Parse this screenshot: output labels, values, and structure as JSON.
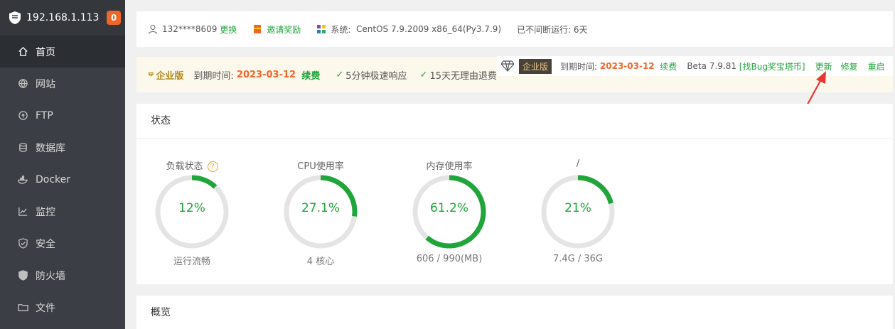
{
  "sidebar": {
    "ip": "192.168.1.113",
    "badge": "0",
    "items": [
      {
        "label": "首页",
        "icon": "home-icon"
      },
      {
        "label": "网站",
        "icon": "globe-icon"
      },
      {
        "label": "FTP",
        "icon": "ftp-icon"
      },
      {
        "label": "数据库",
        "icon": "database-icon"
      },
      {
        "label": "Docker",
        "icon": "docker-icon"
      },
      {
        "label": "监控",
        "icon": "monitor-icon"
      },
      {
        "label": "安全",
        "icon": "shield-icon"
      },
      {
        "label": "防火墙",
        "icon": "firewall-icon"
      },
      {
        "label": "文件",
        "icon": "folder-icon"
      }
    ]
  },
  "topbar": {
    "user": "132****8609",
    "change": "更换",
    "invite": "邀请奖励",
    "system_label": "系统:",
    "system_value": "CentOS 7.9.2009 x86_64(Py3.7.9)",
    "uptime": "已不间断运行: 6天"
  },
  "enterprise": {
    "left_title": "企业版",
    "expire_label": "到期时间:",
    "expire_date": "2023-03-12",
    "renew": "续费",
    "feature1": "5分钟极速响应",
    "feature2": "15天无理由退费",
    "tag": "企业版",
    "r_expire_label": "到期时间:",
    "r_expire_date": "2023-03-12",
    "r_renew": "续费",
    "version": "Beta 7.9.81",
    "bug": "[找Bug奖宝塔币]",
    "update": "更新",
    "repair": "修复",
    "restart": "重启"
  },
  "status": {
    "title": "状态",
    "gauges": [
      {
        "label": "负载状态",
        "value": "12%",
        "percent": 12,
        "sub": "运行流畅",
        "help": "?"
      },
      {
        "label": "CPU使用率",
        "value": "27.1%",
        "percent": 27.1,
        "sub": "4 核心"
      },
      {
        "label": "内存使用率",
        "value": "61.2%",
        "percent": 61.2,
        "sub": "606 / 990(MB)"
      },
      {
        "label": "/",
        "value": "21%",
        "percent": 21,
        "sub": "7.4G / 36G"
      }
    ]
  },
  "overview": {
    "title": "概览"
  },
  "colors": {
    "accent": "#20a53a",
    "orange": "#f0662a",
    "sidebar": "#3b3f45"
  }
}
